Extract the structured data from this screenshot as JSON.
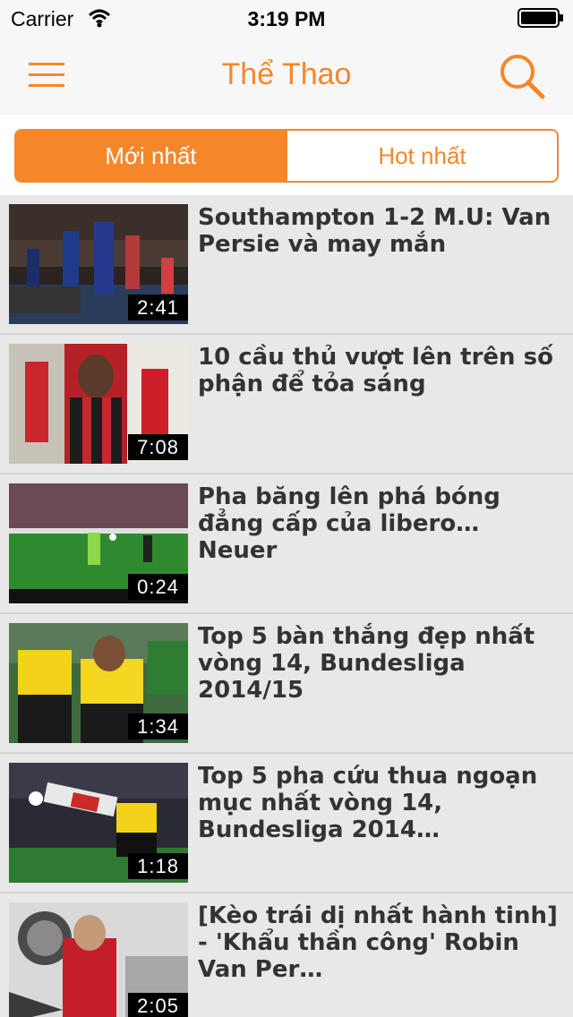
{
  "status_bar": {
    "carrier": "Carrier",
    "time": "3:19 PM"
  },
  "nav": {
    "title": "Thể Thao",
    "menu_icon": "hamburger-menu-icon",
    "search_icon": "search-icon"
  },
  "tabs": {
    "newest": "Mới nhất",
    "hot": "Hot nhất"
  },
  "videos": [
    {
      "title": "Southampton 1-2 M.U: Van Persie và may mắn",
      "duration": "2:41"
    },
    {
      "title": "10 cầu thủ vượt lên trên số phận để tỏa sáng",
      "duration": "7:08"
    },
    {
      "title": "Pha băng lên phá bóng đẳng cấp của libero… Neuer",
      "duration": "0:24"
    },
    {
      "title": "Top 5 bàn thắng đẹp nhất vòng 14, Bundesliga 2014/15",
      "duration": "1:34"
    },
    {
      "title": "Top 5 pha cứu thua ngoạn mục nhất vòng 14, Bundesliga 2014…",
      "duration": "1:18"
    },
    {
      "title": "[Kèo trái dị nhất hành tinh] - 'Khẩu thần công' Robin Van Per…",
      "duration": "2:05"
    }
  ],
  "colors": {
    "accent": "#f5872a",
    "background": "#e8e8e8",
    "title_text": "#333333"
  }
}
